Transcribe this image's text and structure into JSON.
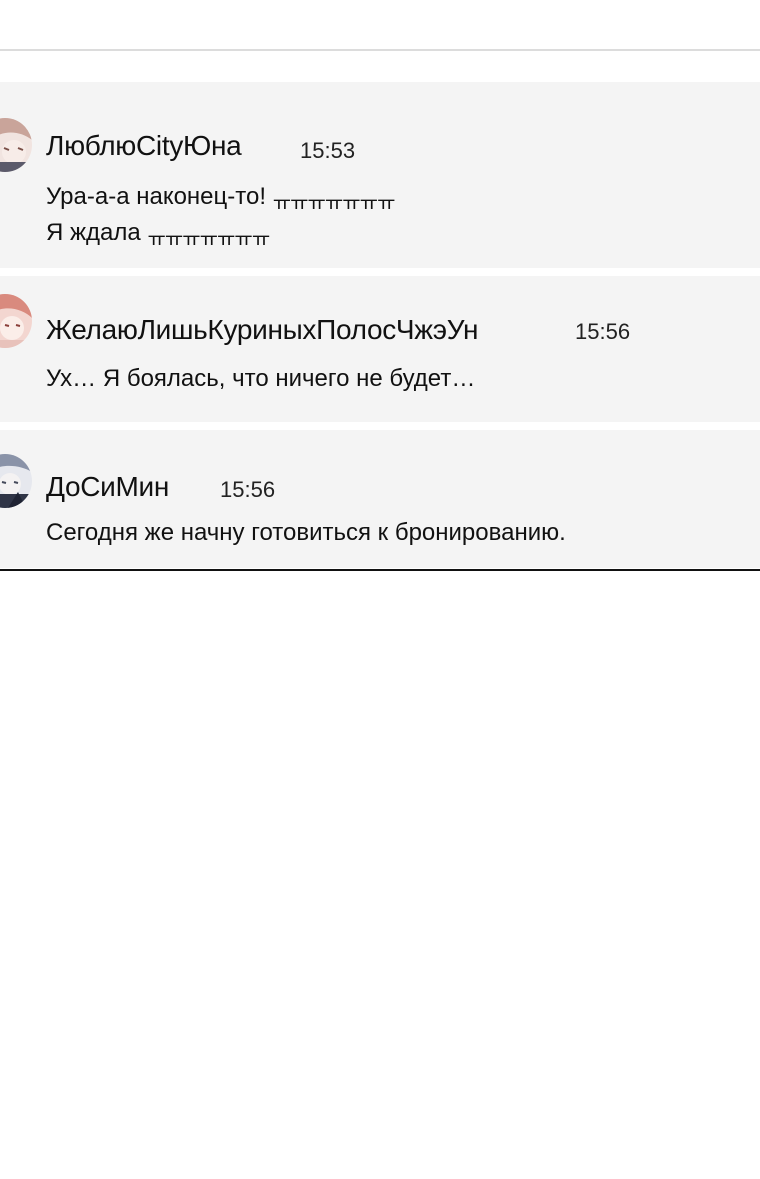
{
  "comments": [
    {
      "author": "ЛюблюCityЮна",
      "time": "15:53",
      "line1": "Ура-а-а наконец-то!",
      "line1_tail": "ㅠㅠㅠㅠㅠㅠㅠ",
      "line2": "Я ждала",
      "line2_tail": "ㅠㅠㅠㅠㅠㅠㅠ"
    },
    {
      "author": "ЖелаюЛишьКуриныхПолосЧжэУн",
      "time": "15:56",
      "text": "Ух… Я боялась, что ничего не будет…"
    },
    {
      "author": "ДоСиМин",
      "time": "15:56",
      "text": "Сегодня же начну готовиться к бронированию."
    }
  ],
  "colors": {
    "comment_bg": "#f4f4f4",
    "text": "#111111",
    "divider": "#dcdcdc",
    "panel_border": "#111111"
  },
  "icons": [
    "avatar-lyublyu-city-yuna",
    "avatar-zhelayu-lish",
    "avatar-dosimin"
  ]
}
